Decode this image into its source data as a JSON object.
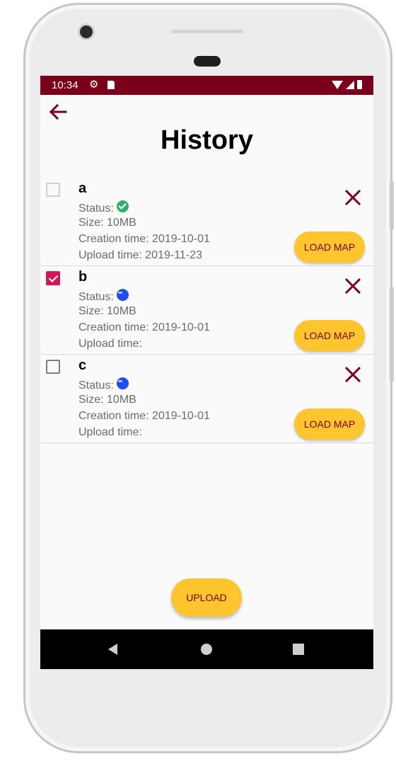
{
  "statusbar": {
    "time": "10:34",
    "icons": [
      "settings-icon",
      "sd-card-icon",
      "wifi-icon",
      "signal-icon",
      "battery-icon"
    ]
  },
  "header": {
    "title": "History",
    "back_icon": "arrow-back-icon"
  },
  "items": [
    {
      "name": "a",
      "checked": false,
      "status_label": "Status:",
      "status_icon": "check-circle-icon",
      "size": "Size: 10MB",
      "creation": "Creation time: 2019-10-01",
      "upload": "Upload time: 2019-11-23",
      "load_label": "LOAD MAP"
    },
    {
      "name": "b",
      "checked": true,
      "status_label": "Status:",
      "status_icon": "more-circle-icon",
      "size": "Size: 10MB",
      "creation": "Creation time: 2019-10-01",
      "upload": "Upload time:",
      "load_label": "LOAD MAP"
    },
    {
      "name": "c",
      "checked": false,
      "status_label": "Status:",
      "status_icon": "more-circle-icon",
      "size": "Size: 10MB",
      "creation": "Creation time: 2019-10-01",
      "upload": "Upload time:",
      "load_label": "LOAD MAP"
    }
  ],
  "footer": {
    "upload_label": "UPLOAD"
  },
  "colors": {
    "primary": "#7a0019",
    "accent": "#fec52e",
    "checkbox": "#d0185a",
    "done": "#2fb06c",
    "pending": "#1f4ee8"
  }
}
